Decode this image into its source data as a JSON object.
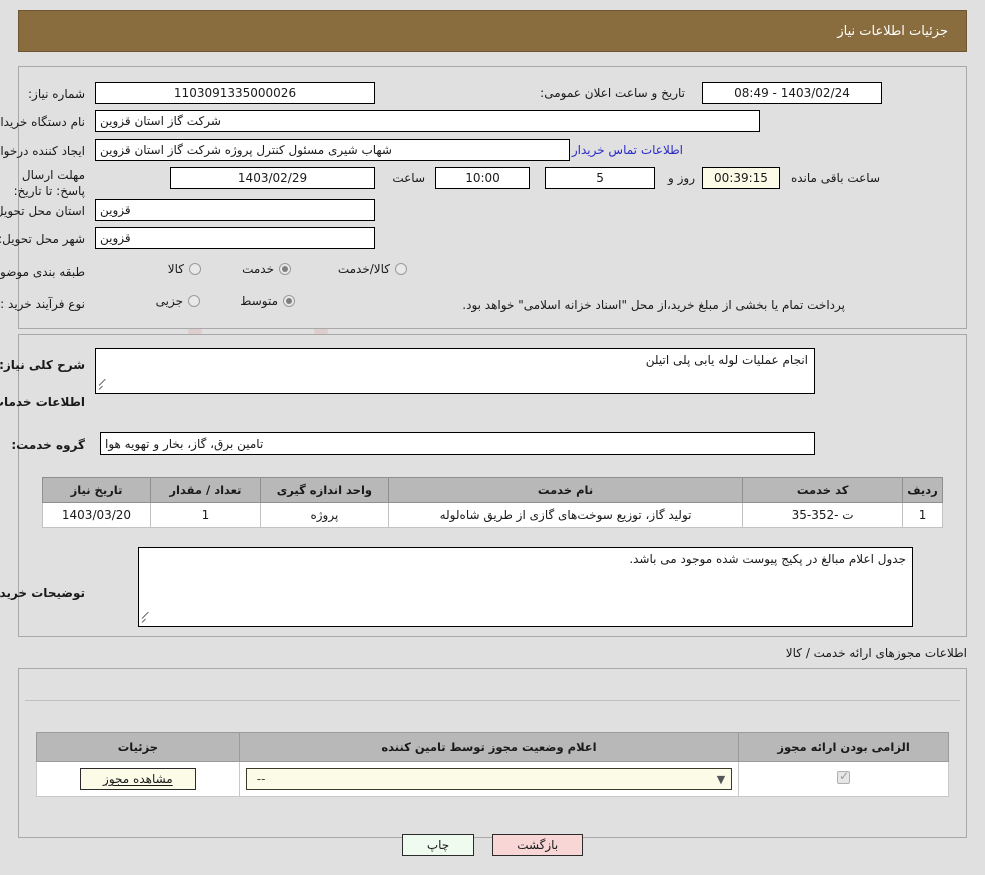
{
  "header": {
    "title": "جزئیات اطلاعات نیاز",
    "bg_color": "#8a6d3f"
  },
  "main": {
    "need_number_label": "شماره نیاز:",
    "need_number_value": "1103091335000026",
    "announce_label": "تاریخ و ساعت اعلان عمومی:",
    "announce_value": "1403/02/24 - 08:49",
    "buyer_org_label": "نام دستگاه خریدار:",
    "buyer_org_value": "شرکت گاز استان قزوین",
    "creator_label": "ایجاد کننده درخواست:",
    "creator_value": "شهاب شیری مسئول کنترل پروژه شرکت گاز استان قزوین",
    "contact_link": "اطلاعات تماس خریدار",
    "deadline_label": "مهلت ارسال پاسخ: تا تاریخ:",
    "deadline_date": "1403/02/29",
    "hour_label": "ساعت",
    "deadline_time": "10:00",
    "days_value": "5",
    "days_label": "روز و",
    "countdown_value": "00:39:15",
    "remaining_label": "ساعت باقی مانده",
    "province_label": "استان محل تحویل:",
    "province_value": "قزوین",
    "city_label": "شهر محل تحویل:",
    "city_value": "قزوین",
    "category_label": "طبقه بندی موضوعی:",
    "category_options": [
      {
        "label": "کالا",
        "selected": false
      },
      {
        "label": "خدمت",
        "selected": true
      },
      {
        "label": "کالا/خدمت",
        "selected": false
      }
    ],
    "process_label": "نوع فرآیند خرید :",
    "process_options": [
      {
        "label": "جزیی",
        "selected": false
      },
      {
        "label": "متوسط",
        "selected": true
      }
    ],
    "payment_note": "پرداخت تمام یا بخشی از مبلغ خرید،از محل \"اسناد خزانه اسلامی\" خواهد بود."
  },
  "description": {
    "summary_label": "شرح کلی نیاز:",
    "summary_value": "انجام عملیات لوله یابی پلی اتیلن",
    "services_heading": "اطلاعات خدمات مورد نیاز",
    "group_label": "گروه خدمت:",
    "group_value": "تامین برق، گاز، بخار و تهویه هوا",
    "buyer_notes_label": "توضیحات خریدار:",
    "buyer_notes_value": "جدول اعلام مبالغ در پکیج پیوست شده موجود می باشد."
  },
  "services_table": {
    "columns": [
      "ردیف",
      "کد خدمت",
      "نام خدمت",
      "واحد اندازه گیری",
      "تعداد / مقدار",
      "تاریخ نیاز"
    ],
    "rows": [
      [
        "1",
        "ت -352-35",
        "تولید گاز، توزیع سوخت‌های گازی از طریق شاه‌لوله",
        "پروژه",
        "1",
        "1403/03/20"
      ]
    ]
  },
  "licenses": {
    "caption": "اطلاعات مجوزهای ارائه خدمت / کالا",
    "columns": [
      "الزامی بودن ارائه مجوز",
      "اعلام وضعیت مجوز توسط تامین کننده",
      "جزئیات"
    ],
    "rows": [
      {
        "required_checked": true,
        "status_value": "--",
        "detail_label": "مشاهده مجوز"
      }
    ]
  },
  "footer": {
    "print_label": "چاپ",
    "back_label": "بازگشت"
  },
  "watermark": {
    "text": "AriaTender.net"
  }
}
